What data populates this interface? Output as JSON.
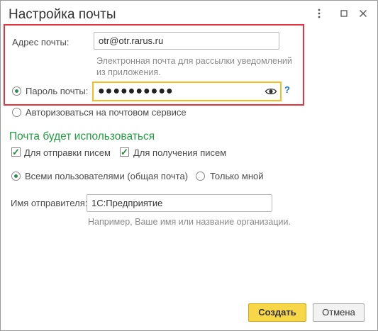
{
  "window": {
    "title": "Настройка почты",
    "menu_icon": "more-vert-icon",
    "maximize_icon": "maximize-icon",
    "close_icon": "close-icon"
  },
  "email": {
    "label": "Адрес почты:",
    "value": "otr@otr.rarus.ru",
    "hint": "Электронная почта для рассылки уведомлений из приложения."
  },
  "password": {
    "radio_label": "Пароль почты:",
    "masked_value": "●●●●●●●●●●",
    "eye_icon": "eye-icon",
    "help": "?"
  },
  "auth_option": {
    "label": "Авторизоваться на почтовом сервисе"
  },
  "usage": {
    "section_title": "Почта будет использоваться",
    "send_label": "Для отправки писем",
    "receive_label": "Для получения писем",
    "all_users_label": "Всеми пользователями (общая почта)",
    "only_me_label": "Только мной"
  },
  "sender": {
    "label": "Имя отправителя:",
    "value": "1С:Предприятие",
    "hint": "Например, Ваше имя или название организации."
  },
  "buttons": {
    "create": "Создать",
    "cancel": "Отмена"
  },
  "colors": {
    "accent_green": "#1e9e3e",
    "highlight_red": "#e0353c",
    "primary_yellow": "#f7d648",
    "focus_yellow": "#f0c020"
  }
}
